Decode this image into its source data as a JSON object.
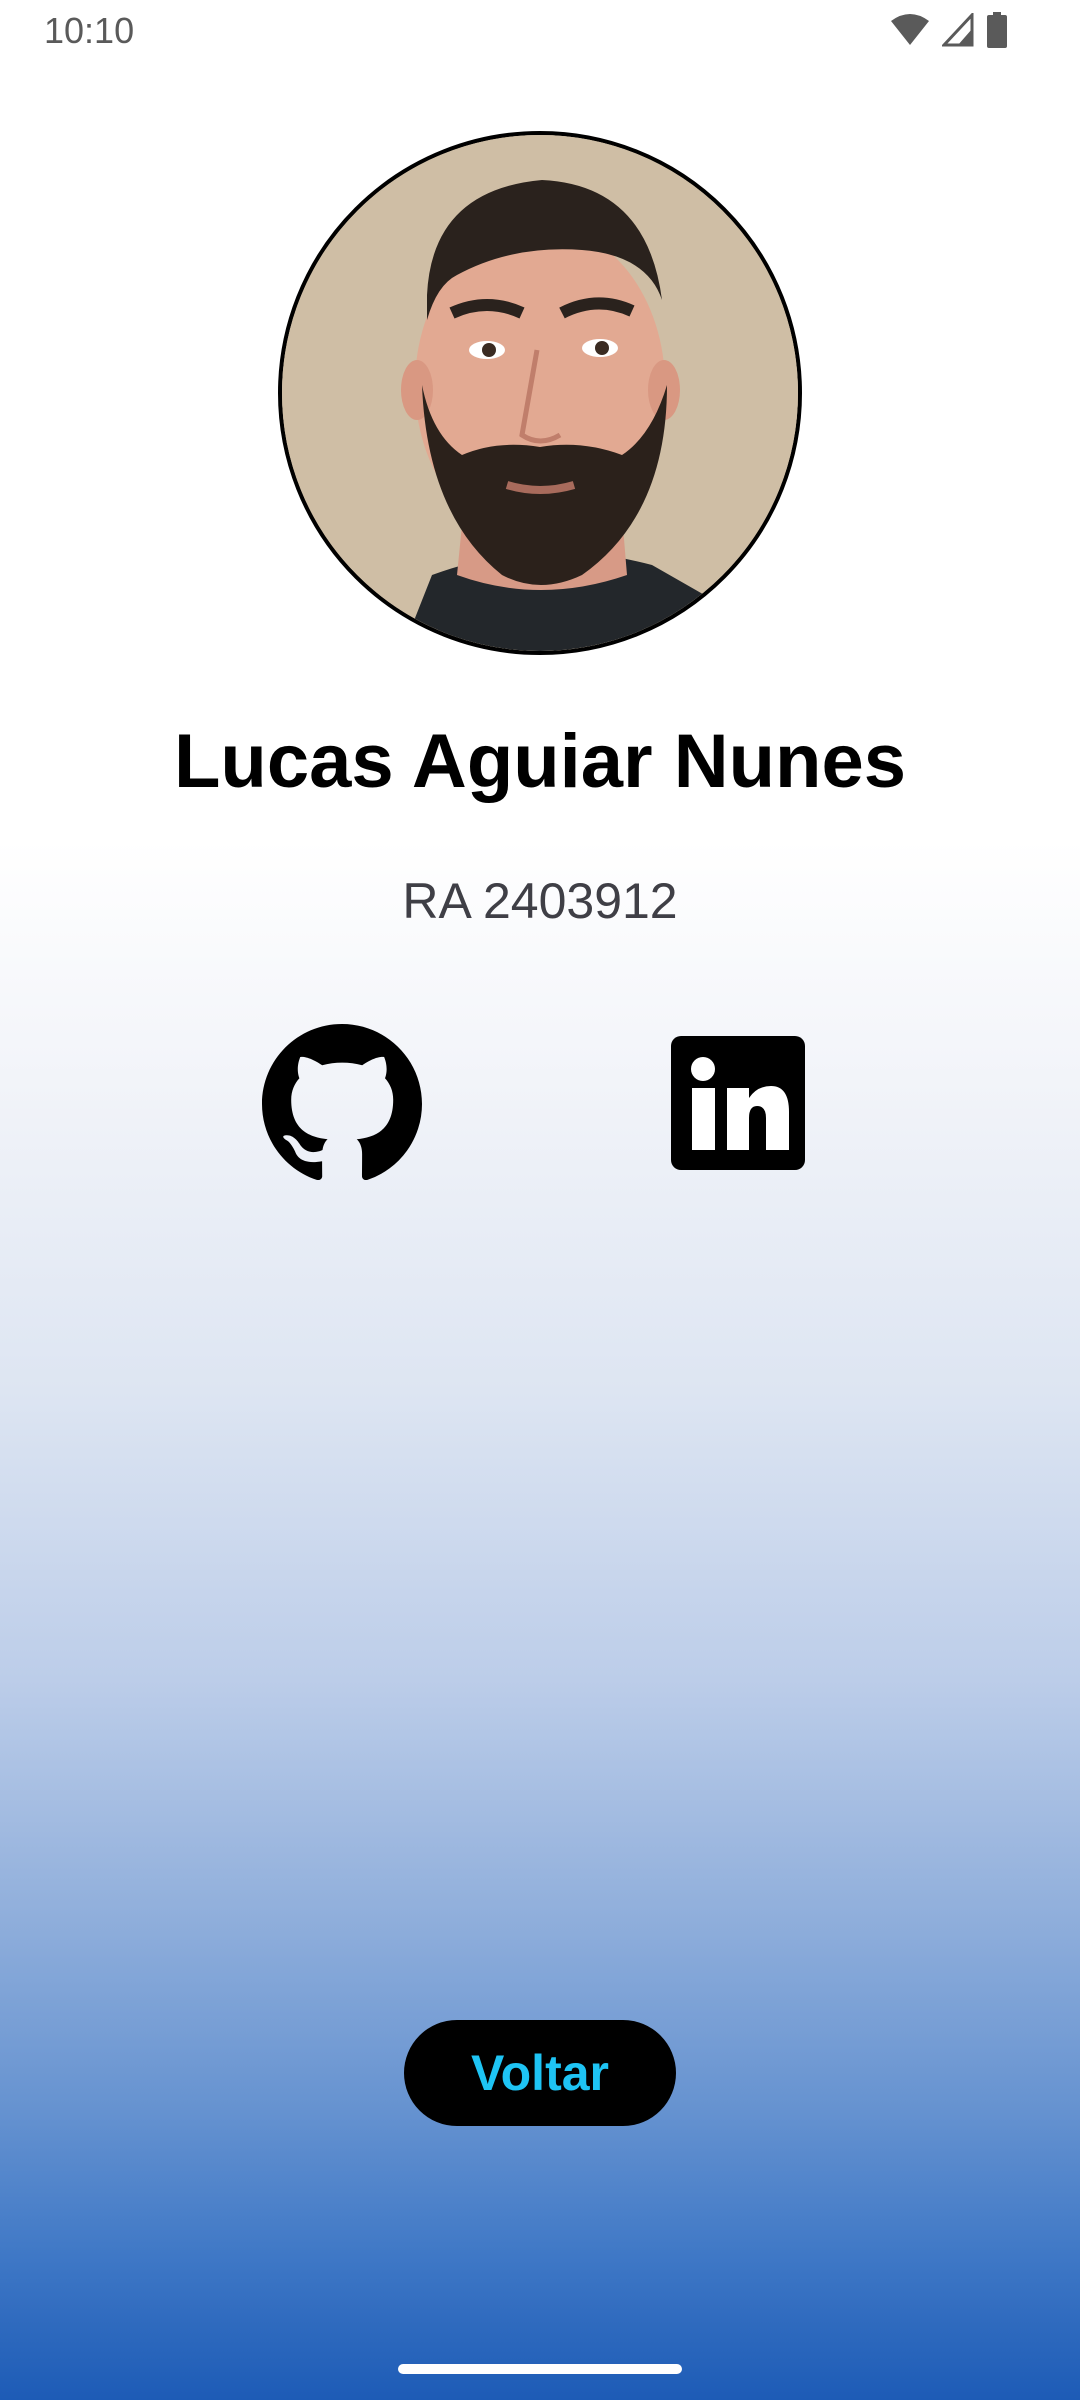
{
  "status_bar": {
    "time": "10:10",
    "icons": [
      "wifi-icon",
      "cell-signal-icon",
      "battery-icon"
    ]
  },
  "profile": {
    "avatar": "profile-photo",
    "name": "Lucas Aguiar Nunes",
    "ra": "RA 2403912"
  },
  "social": {
    "icons": [
      "github-icon",
      "linkedin-icon"
    ]
  },
  "actions": {
    "back_label": "Voltar"
  },
  "colors": {
    "button_background": "#000000",
    "button_text": "#1ec4f4",
    "gradient_bottom": "#1d5bb6"
  }
}
